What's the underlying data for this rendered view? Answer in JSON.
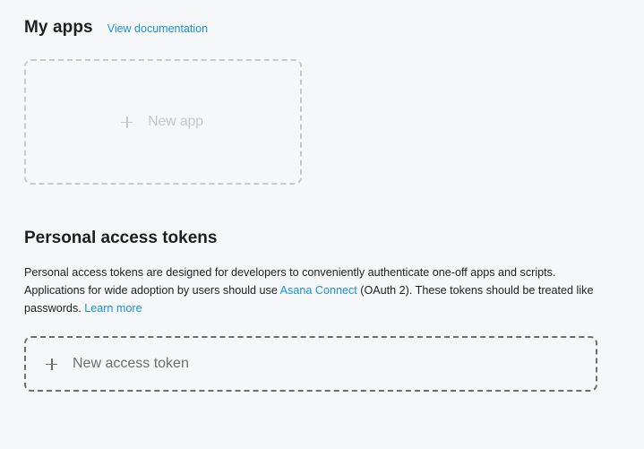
{
  "apps": {
    "title": "My apps",
    "doc_link": "View documentation",
    "new_app_label": "New app",
    "new_app_icon": "plus-icon"
  },
  "tokens": {
    "title": "Personal access tokens",
    "desc_part1": "Personal access tokens are designed for developers to conveniently authenticate one-off apps and scripts. Applications for wide adoption by users should use ",
    "asana_connect_link": "Asana Connect",
    "desc_part2": " (OAuth 2). These tokens should be treated like passwords. ",
    "learn_more_link": "Learn more",
    "new_token_label": "New access token",
    "new_token_icon": "plus-icon"
  },
  "colors": {
    "background": "#f6f7f9",
    "link": "#1a8fd9",
    "text": "#1e1f21",
    "muted": "#6d6e6f",
    "disabled": "#c4c7cc"
  }
}
